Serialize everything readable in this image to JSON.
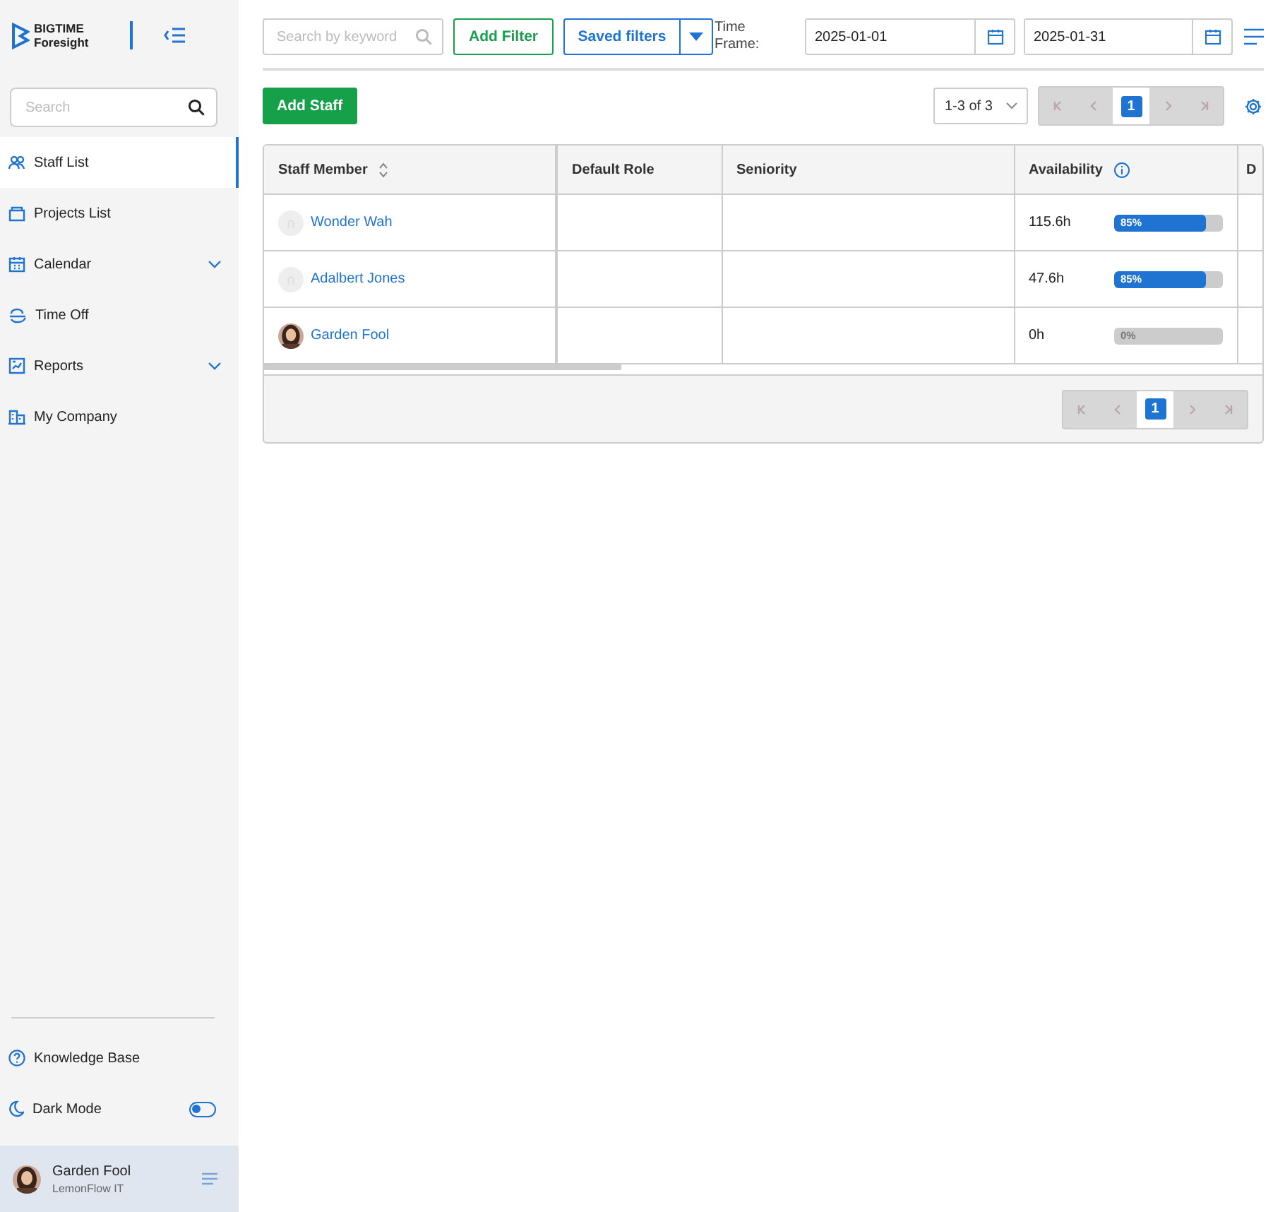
{
  "sidebar": {
    "logo": {
      "line1": "BIGTIME",
      "line2": "Foresight"
    },
    "search": {
      "placeholder": "Search"
    },
    "items": [
      {
        "label": "Staff List",
        "selected": true,
        "expandable": false
      },
      {
        "label": "Projects List",
        "selected": false,
        "expandable": false
      },
      {
        "label": "Calendar",
        "selected": false,
        "expandable": true
      },
      {
        "label": "Time Off",
        "selected": false,
        "expandable": false
      },
      {
        "label": "Reports",
        "selected": false,
        "expandable": true
      },
      {
        "label": "My Company",
        "selected": false,
        "expandable": false
      }
    ],
    "bottom_items": [
      {
        "label": "Knowledge Base",
        "kind": "link"
      },
      {
        "label": "Dark Mode",
        "kind": "toggle",
        "on": false
      }
    ],
    "user": {
      "name": "Garden Fool",
      "company": "LemonFlow IT"
    }
  },
  "toolbar": {
    "search": {
      "placeholder": "Search by keyword"
    },
    "add_filter": "Add Filter",
    "saved_filters": "Saved filters",
    "time_frame_label": "Time Frame:",
    "start_date": "2025-01-01",
    "end_date": "2025-01-31"
  },
  "actions": {
    "add_staff": "Add Staff",
    "range": "1-3 of 3",
    "pages": [
      {
        "label": "1",
        "selected": true
      }
    ]
  },
  "table": {
    "columns": [
      "Staff Member",
      "Default Role",
      "Seniority",
      "Availability",
      "D"
    ],
    "rows": [
      {
        "name": "Wonder Wah",
        "kind": "placeholder",
        "hours": "115.6h",
        "level": 0.85,
        "reading": "85%"
      },
      {
        "name": "Adalbert Jones",
        "kind": "placeholder",
        "hours": "47.6h",
        "level": 0.85,
        "reading": "85%"
      },
      {
        "name": "Garden Fool",
        "hours": "0h",
        "level": 0,
        "reading": "0%"
      }
    ],
    "footer_pages": [
      {
        "label": "1",
        "selected": true
      }
    ]
  }
}
